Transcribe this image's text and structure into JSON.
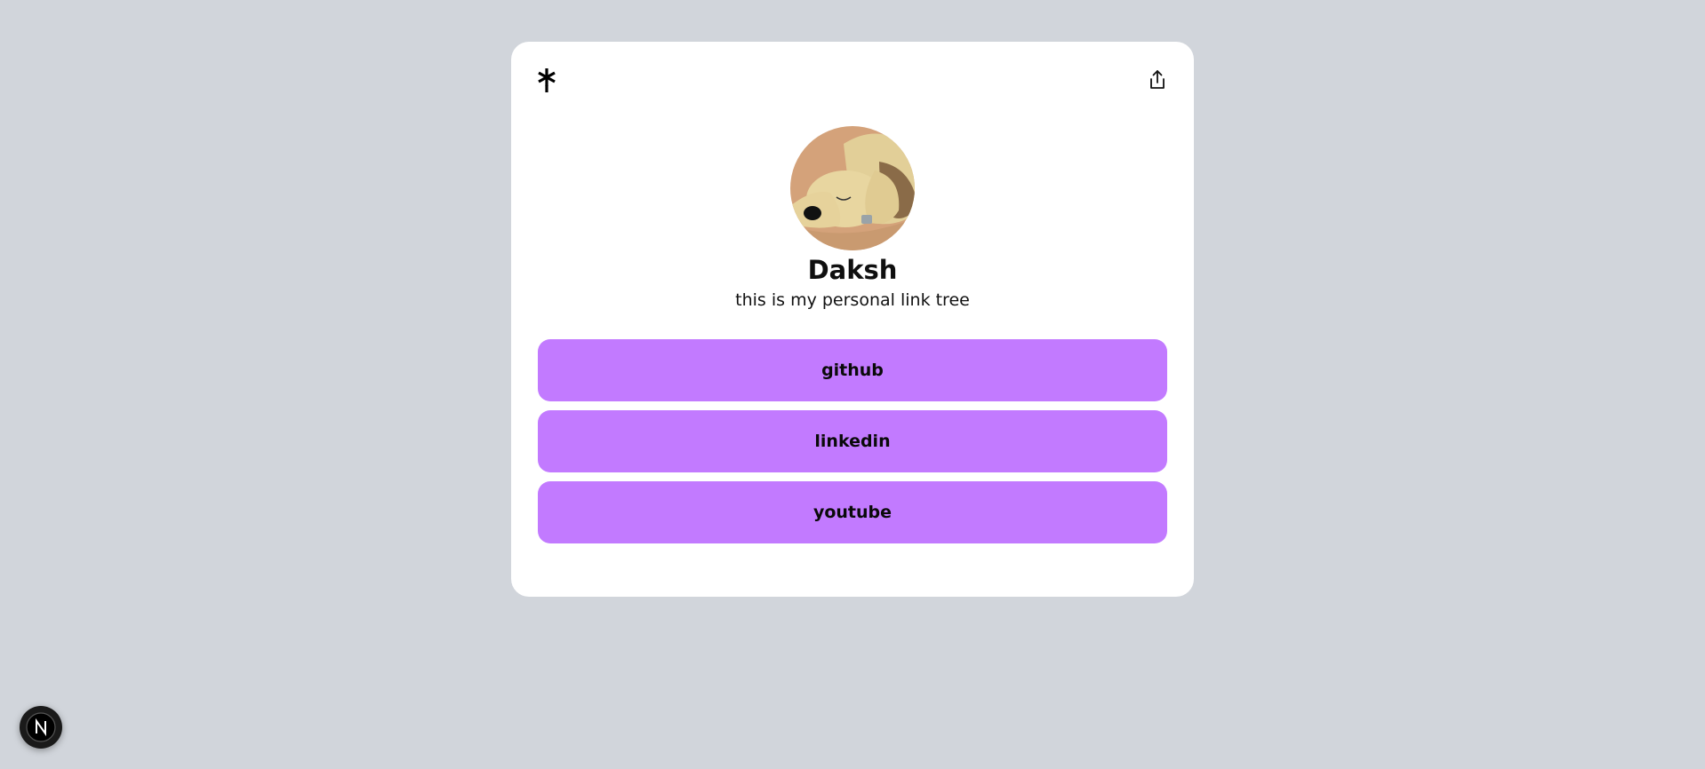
{
  "icons": {
    "logo": "linktree-asterisk-icon",
    "share": "share-upload-icon",
    "badge": "nextjs-n-icon",
    "avatar": "sleeping-dog-avatar"
  },
  "profile": {
    "name": "Daksh",
    "bio": "this is my personal link tree"
  },
  "links": [
    {
      "label": "github"
    },
    {
      "label": "linkedin"
    },
    {
      "label": "youtube"
    }
  ],
  "colors": {
    "page_background": "#d1d5db",
    "card_background": "#ffffff",
    "button_background": "#c27aff",
    "badge_background": "#1a1a1a"
  }
}
